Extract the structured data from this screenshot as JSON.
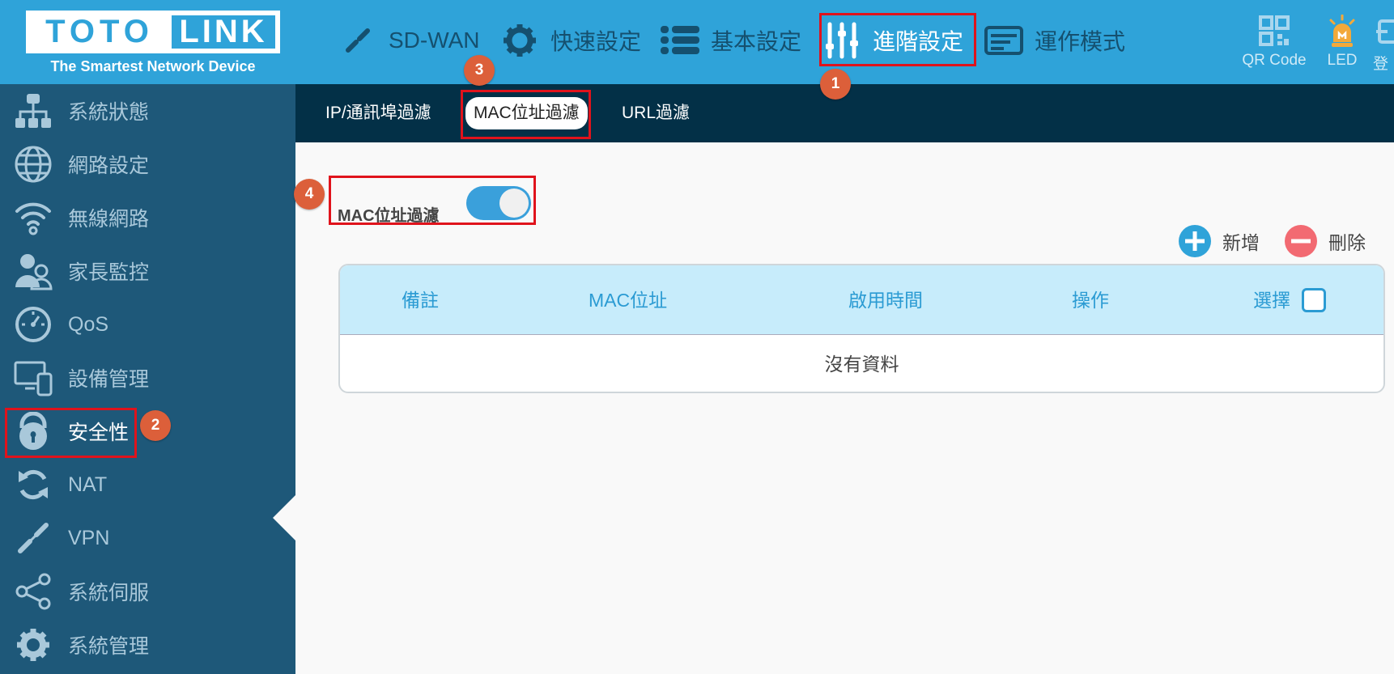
{
  "brand": {
    "logo_left": "TOTO",
    "logo_right": "LINK",
    "tagline": "The Smartest Network Device"
  },
  "topnav": [
    {
      "label": "SD-WAN",
      "icon": "link-icon"
    },
    {
      "label": "快速設定",
      "icon": "gear-icon"
    },
    {
      "label": "基本設定",
      "icon": "list-icon"
    },
    {
      "label": "進階設定",
      "icon": "sliders-icon",
      "active": true
    },
    {
      "label": "運作模式",
      "icon": "router-icon"
    }
  ],
  "header_right": {
    "qr_label": "QR Code",
    "led_label": "LED",
    "login_label": "登"
  },
  "sidebar": [
    {
      "label": "系統狀態",
      "icon": "network-status-icon"
    },
    {
      "label": "網路設定",
      "icon": "globe-icon"
    },
    {
      "label": "無線網路",
      "icon": "wifi-icon"
    },
    {
      "label": "家長監控",
      "icon": "parental-icon"
    },
    {
      "label": "QoS",
      "icon": "gauge-icon"
    },
    {
      "label": "設備管理",
      "icon": "devices-icon"
    },
    {
      "label": "安全性",
      "icon": "lock-icon",
      "active": true
    },
    {
      "label": "NAT",
      "icon": "refresh-icon"
    },
    {
      "label": "VPN",
      "icon": "chain-icon"
    },
    {
      "label": "系統伺服",
      "icon": "share-icon"
    },
    {
      "label": "系統管理",
      "icon": "settings-icon"
    }
  ],
  "subtabs": [
    {
      "label": "IP/通訊埠過濾"
    },
    {
      "label": "MAC位址過濾",
      "active": true
    },
    {
      "label": "URL過濾"
    }
  ],
  "filter": {
    "toggle_label": "MAC位址過濾",
    "enabled": true
  },
  "actions": {
    "add_label": "新增",
    "delete_label": "刪除"
  },
  "table": {
    "columns": [
      "備註",
      "MAC位址",
      "啟用時間",
      "操作",
      "選擇"
    ],
    "empty_text": "沒有資料"
  },
  "annotations": [
    "1",
    "2",
    "3",
    "4"
  ],
  "colors": {
    "header": "#2fa3d9",
    "sidebar": "#1e5879",
    "subtab_bar": "#033047",
    "highlight": "#e0131c",
    "badge": "#dc5f3a",
    "add": "#2fa3d9",
    "delete": "#f26a72"
  }
}
